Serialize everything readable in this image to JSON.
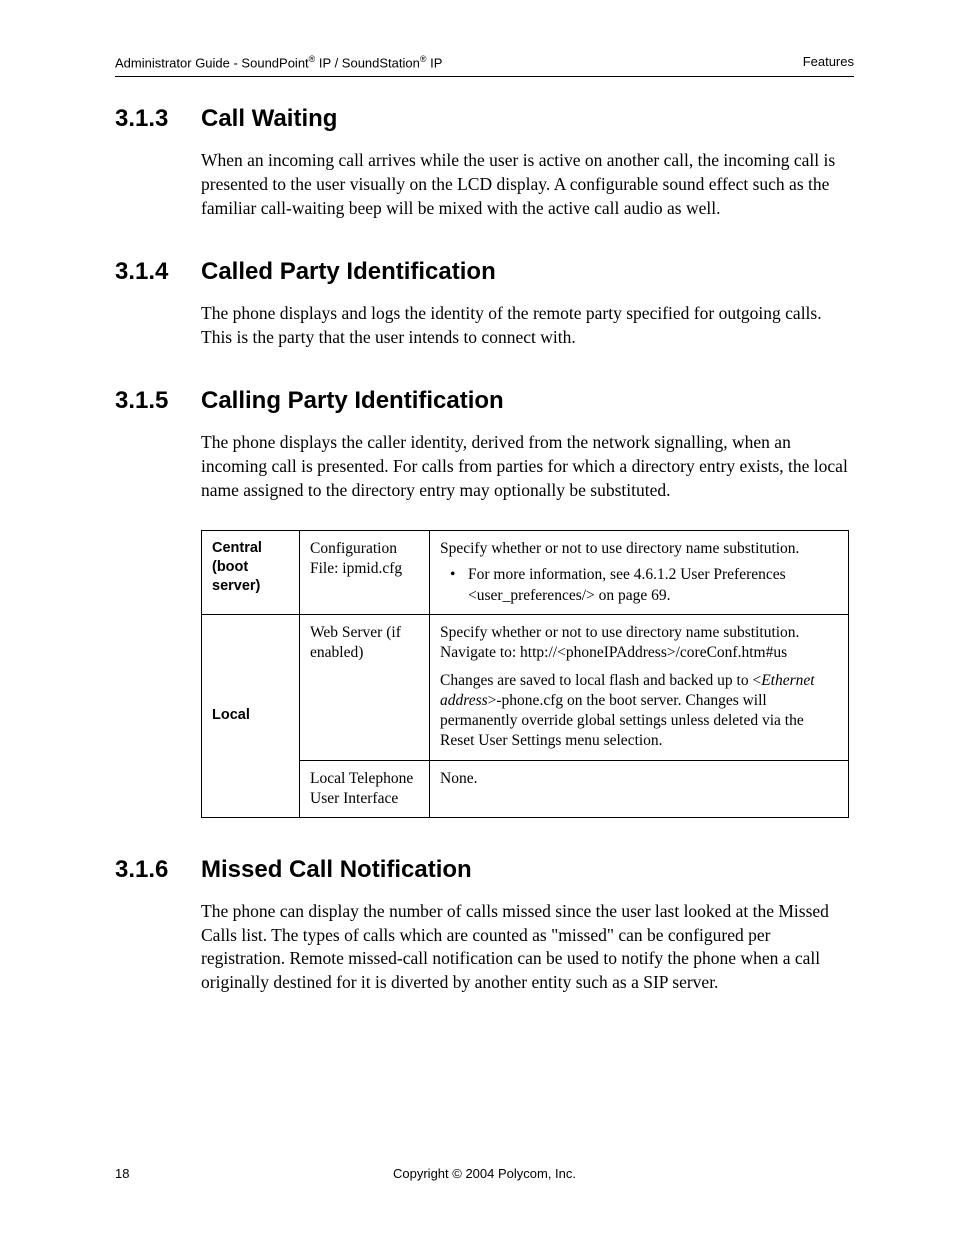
{
  "header": {
    "left_prefix": "Administrator Guide - SoundPoint",
    "left_mid": " IP / SoundStation",
    "left_suffix": " IP",
    "reg": "®",
    "right": "Features"
  },
  "sections": {
    "s313": {
      "num": "3.1.3",
      "title": "Call Waiting",
      "body": "When an incoming call arrives while the user is active on another call, the incoming call is presented to the user visually on the LCD display.  A configurable sound effect such as the familiar call-waiting beep will be mixed with the active call audio as well."
    },
    "s314": {
      "num": "3.1.4",
      "title": "Called Party Identification",
      "body": "The phone displays and logs the identity of the remote party specified for outgoing calls.  This is the party that the user intends to connect with."
    },
    "s315": {
      "num": "3.1.5",
      "title": "Calling Party Identification",
      "body": "The phone displays the caller identity, derived from the network signalling, when an incoming call is presented.  For calls from parties for which a directory entry exists, the local name assigned to the directory entry may optionally be substituted."
    },
    "s316": {
      "num": "3.1.6",
      "title": "Missed Call Notification",
      "body": "The phone can display the number of calls missed since the user last looked at the Missed Calls list. The types of calls which are counted as \"missed\" can be configured per registration. Remote missed-call notification can be used to notify the phone when a call originally destined for it is diverted by another entity such as a SIP server."
    }
  },
  "table": {
    "row1": {
      "label": "Central (boot server)",
      "mid": "Configuration File: ipmid.cfg",
      "right_line": "Specify whether or not to use directory name substitution.",
      "bullet": "For more information, see 4.6.1.2 User Preferences <user_preferences/> on page 69."
    },
    "row2": {
      "label": "Local",
      "mid": "Web Server (if enabled)",
      "right_l1": "Specify whether or not to use directory name substitution. Navigate to: http://<phoneIPAddress>/coreConf.htm#us",
      "right_l2a": "Changes are saved to local flash and backed up to <",
      "right_l2b": "Ethernet address",
      "right_l2c": ">-phone.cfg on the boot server.  Changes will permanently override global settings unless deleted via the Reset User Settings menu selection."
    },
    "row3": {
      "mid": "Local Telephone User Interface",
      "right": "None."
    }
  },
  "footer": {
    "page": "18",
    "copyright": "Copyright © 2004 Polycom, Inc."
  }
}
